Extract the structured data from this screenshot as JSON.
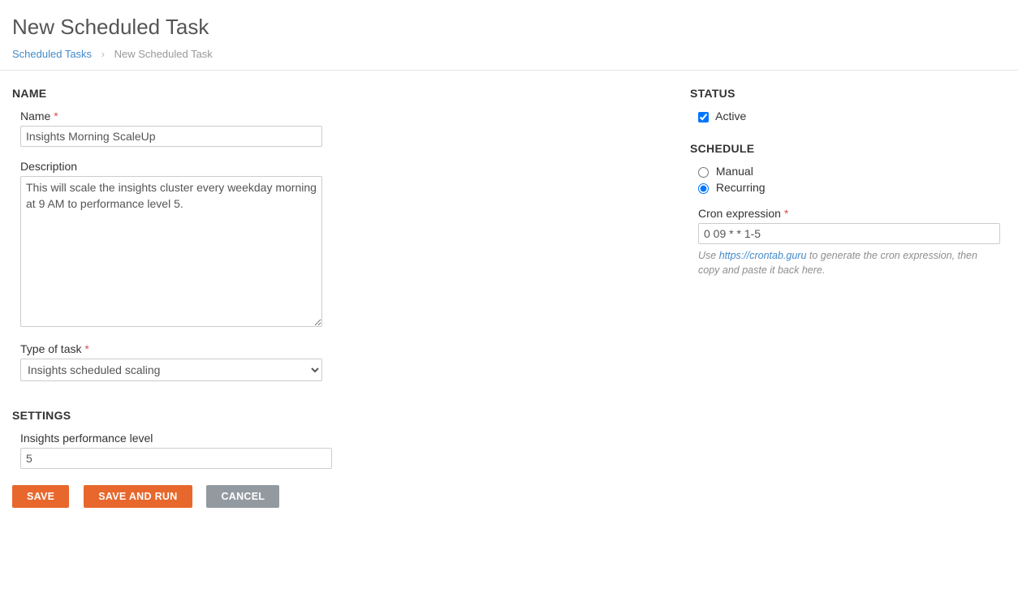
{
  "header": {
    "title": "New Scheduled Task",
    "breadcrumb_link": "Scheduled Tasks",
    "breadcrumb_current": "New Scheduled Task"
  },
  "left": {
    "section_name": "NAME",
    "name_label": "Name",
    "name_value": "Insights Morning ScaleUp",
    "description_label": "Description",
    "description_value": "This will scale the insights cluster every weekday morning at 9 AM to performance level 5.",
    "task_type_label": "Type of task",
    "task_type_value": "Insights scheduled scaling",
    "section_settings": "SETTINGS",
    "perf_label": "Insights performance level",
    "perf_value": "5"
  },
  "right": {
    "section_status": "STATUS",
    "active_label": "Active",
    "active_checked": true,
    "section_schedule": "SCHEDULE",
    "manual_label": "Manual",
    "recurring_label": "Recurring",
    "schedule_mode": "recurring",
    "cron_label": "Cron expression",
    "cron_value": "0 09 * * 1-5",
    "help_prefix": "Use ",
    "help_link_text": "https://crontab.guru",
    "help_suffix": " to generate the cron expression, then copy and paste it back here."
  },
  "buttons": {
    "save": "SAVE",
    "save_and_run": "SAVE AND RUN",
    "cancel": "CANCEL"
  }
}
